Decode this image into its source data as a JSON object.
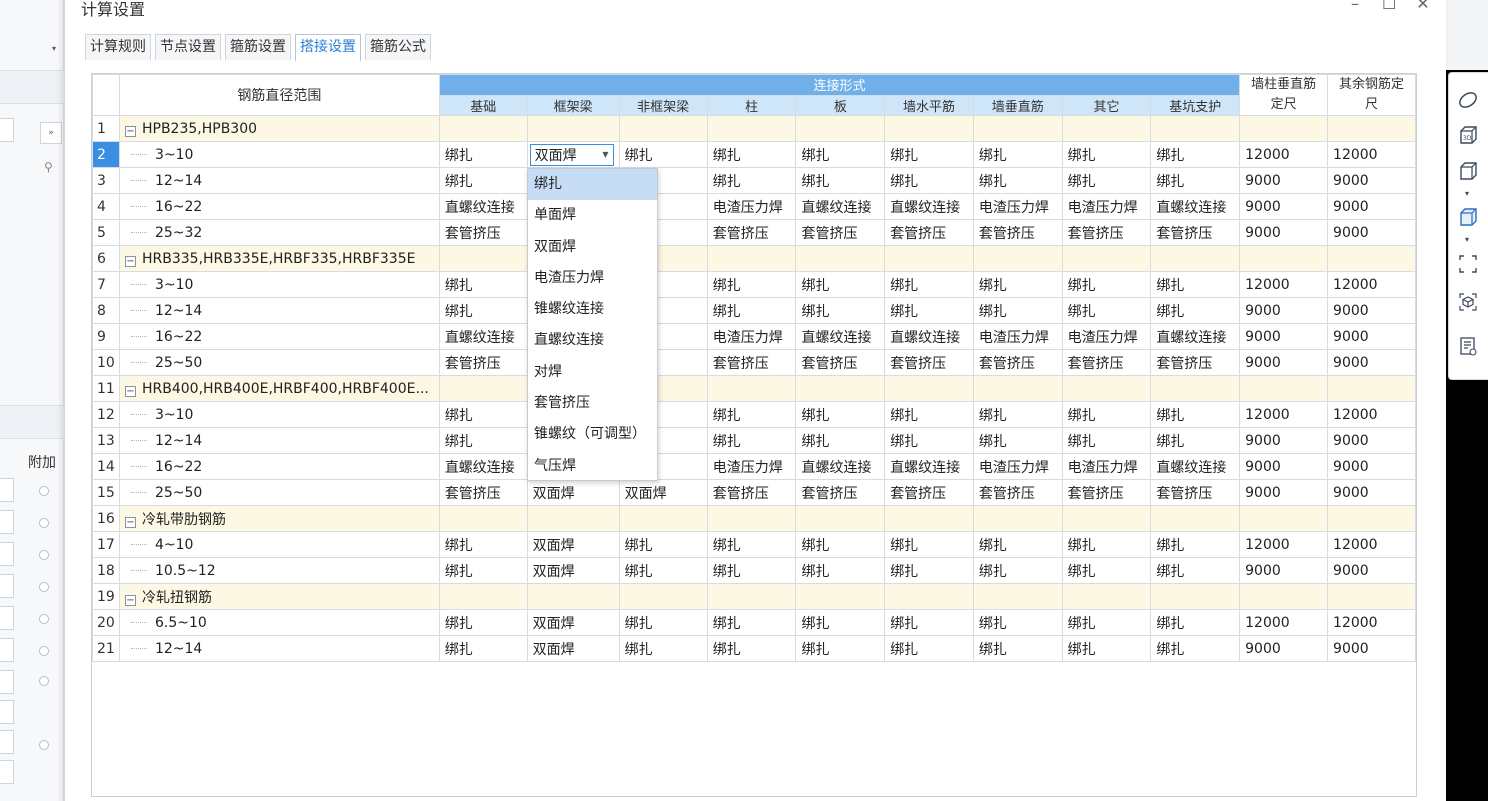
{
  "dialog": {
    "title": "计算设置",
    "controls": {
      "minimize": "–",
      "maximize": "☐",
      "close": "✕"
    }
  },
  "tabs": [
    {
      "label": "计算规则",
      "active": false
    },
    {
      "label": "节点设置",
      "active": false
    },
    {
      "label": "箍筋设置",
      "active": false
    },
    {
      "label": "搭接设置",
      "active": true
    },
    {
      "label": "箍筋公式",
      "active": false
    }
  ],
  "grid": {
    "range_header": "钢筋直径范围",
    "group_header": "连接形式",
    "columns": [
      "基础",
      "框架梁",
      "非框架梁",
      "柱",
      "板",
      "墙水平筋",
      "墙垂直筋",
      "其它",
      "基坑支护"
    ],
    "wall_col_header": "墙柱垂直筋定尺",
    "other_col_header": "其余钢筋定尺",
    "rows": [
      {
        "no": "1",
        "group": true,
        "label": "HPB235,HPB300"
      },
      {
        "no": "2",
        "label": "3~10",
        "cells": [
          "绑扎",
          "双面焊",
          "绑扎",
          "绑扎",
          "绑扎",
          "绑扎",
          "绑扎",
          "绑扎",
          "绑扎"
        ],
        "wall": "12000",
        "other": "12000"
      },
      {
        "no": "3",
        "label": "12~14",
        "cells": [
          "绑扎",
          "",
          "",
          "绑扎",
          "绑扎",
          "绑扎",
          "绑扎",
          "绑扎",
          "绑扎"
        ],
        "wall": "9000",
        "other": "9000"
      },
      {
        "no": "4",
        "label": "16~22",
        "cells": [
          "直螺纹连接",
          "",
          "焊",
          "电渣压力焊",
          "直螺纹连接",
          "直螺纹连接",
          "电渣压力焊",
          "电渣压力焊",
          "直螺纹连接"
        ],
        "wall": "9000",
        "other": "9000"
      },
      {
        "no": "5",
        "label": "25~32",
        "cells": [
          "套管挤压",
          "",
          "压",
          "套管挤压",
          "套管挤压",
          "套管挤压",
          "套管挤压",
          "套管挤压",
          "套管挤压"
        ],
        "wall": "9000",
        "other": "9000"
      },
      {
        "no": "6",
        "group": true,
        "label": "HRB335,HRB335E,HRBF335,HRBF335E"
      },
      {
        "no": "7",
        "label": "3~10",
        "cells": [
          "绑扎",
          "",
          "",
          "绑扎",
          "绑扎",
          "绑扎",
          "绑扎",
          "绑扎",
          "绑扎"
        ],
        "wall": "12000",
        "other": "12000"
      },
      {
        "no": "8",
        "label": "12~14",
        "cells": [
          "绑扎",
          "",
          "",
          "绑扎",
          "绑扎",
          "绑扎",
          "绑扎",
          "绑扎",
          "绑扎"
        ],
        "wall": "9000",
        "other": "9000"
      },
      {
        "no": "9",
        "label": "16~22",
        "cells": [
          "直螺纹连接",
          "",
          "焊",
          "电渣压力焊",
          "直螺纹连接",
          "直螺纹连接",
          "电渣压力焊",
          "电渣压力焊",
          "直螺纹连接"
        ],
        "wall": "9000",
        "other": "9000"
      },
      {
        "no": "10",
        "label": "25~50",
        "cells": [
          "套管挤压",
          "",
          "压",
          "套管挤压",
          "套管挤压",
          "套管挤压",
          "套管挤压",
          "套管挤压",
          "套管挤压"
        ],
        "wall": "9000",
        "other": "9000"
      },
      {
        "no": "11",
        "group": true,
        "label": "HRB400,HRB400E,HRBF400,HRBF400E..."
      },
      {
        "no": "12",
        "label": "3~10",
        "cells": [
          "绑扎",
          "",
          "",
          "绑扎",
          "绑扎",
          "绑扎",
          "绑扎",
          "绑扎",
          "绑扎"
        ],
        "wall": "12000",
        "other": "12000"
      },
      {
        "no": "13",
        "label": "12~14",
        "cells": [
          "绑扎",
          "",
          "",
          "绑扎",
          "绑扎",
          "绑扎",
          "绑扎",
          "绑扎",
          "绑扎"
        ],
        "wall": "9000",
        "other": "9000"
      },
      {
        "no": "14",
        "label": "16~22",
        "cells": [
          "直螺纹连接",
          "",
          "焊",
          "电渣压力焊",
          "直螺纹连接",
          "直螺纹连接",
          "电渣压力焊",
          "电渣压力焊",
          "直螺纹连接"
        ],
        "wall": "9000",
        "other": "9000"
      },
      {
        "no": "15",
        "label": "25~50",
        "cells": [
          "套管挤压",
          "双面焊",
          "双面焊",
          "套管挤压",
          "套管挤压",
          "套管挤压",
          "套管挤压",
          "套管挤压",
          "套管挤压"
        ],
        "wall": "9000",
        "other": "9000"
      },
      {
        "no": "16",
        "group": true,
        "label": "冷轧带肋钢筋"
      },
      {
        "no": "17",
        "label": "4~10",
        "cells": [
          "绑扎",
          "双面焊",
          "绑扎",
          "绑扎",
          "绑扎",
          "绑扎",
          "绑扎",
          "绑扎",
          "绑扎"
        ],
        "wall": "12000",
        "other": "12000"
      },
      {
        "no": "18",
        "label": "10.5~12",
        "cells": [
          "绑扎",
          "双面焊",
          "绑扎",
          "绑扎",
          "绑扎",
          "绑扎",
          "绑扎",
          "绑扎",
          "绑扎"
        ],
        "wall": "9000",
        "other": "9000"
      },
      {
        "no": "19",
        "group": true,
        "label": "冷轧扭钢筋"
      },
      {
        "no": "20",
        "label": "6.5~10",
        "cells": [
          "绑扎",
          "双面焊",
          "绑扎",
          "绑扎",
          "绑扎",
          "绑扎",
          "绑扎",
          "绑扎",
          "绑扎"
        ],
        "wall": "12000",
        "other": "12000"
      },
      {
        "no": "21",
        "label": "12~14",
        "cells": [
          "绑扎",
          "双面焊",
          "绑扎",
          "绑扎",
          "绑扎",
          "绑扎",
          "绑扎",
          "绑扎",
          "绑扎"
        ],
        "wall": "9000",
        "other": "9000"
      }
    ]
  },
  "dropdown": {
    "options": [
      "绑扎",
      "单面焊",
      "双面焊",
      "电渣压力焊",
      "锥螺纹连接",
      "直螺纹连接",
      "对焊",
      "套管挤压",
      "锥螺纹（可调型）",
      "气压焊"
    ],
    "highlighted": "绑扎"
  },
  "background": {
    "left_label": "附加"
  },
  "side_toolbar": {
    "icons": [
      "ellipse-icon",
      "3d-view-icon",
      "box-icon",
      "box-solid-icon",
      "frame-select-icon",
      "cube-select-icon",
      "list-view-icon"
    ]
  },
  "colors": {
    "accent": "#3a8fe3",
    "header_blue": "#6fb0ea",
    "group_row": "#fdf8e3"
  }
}
